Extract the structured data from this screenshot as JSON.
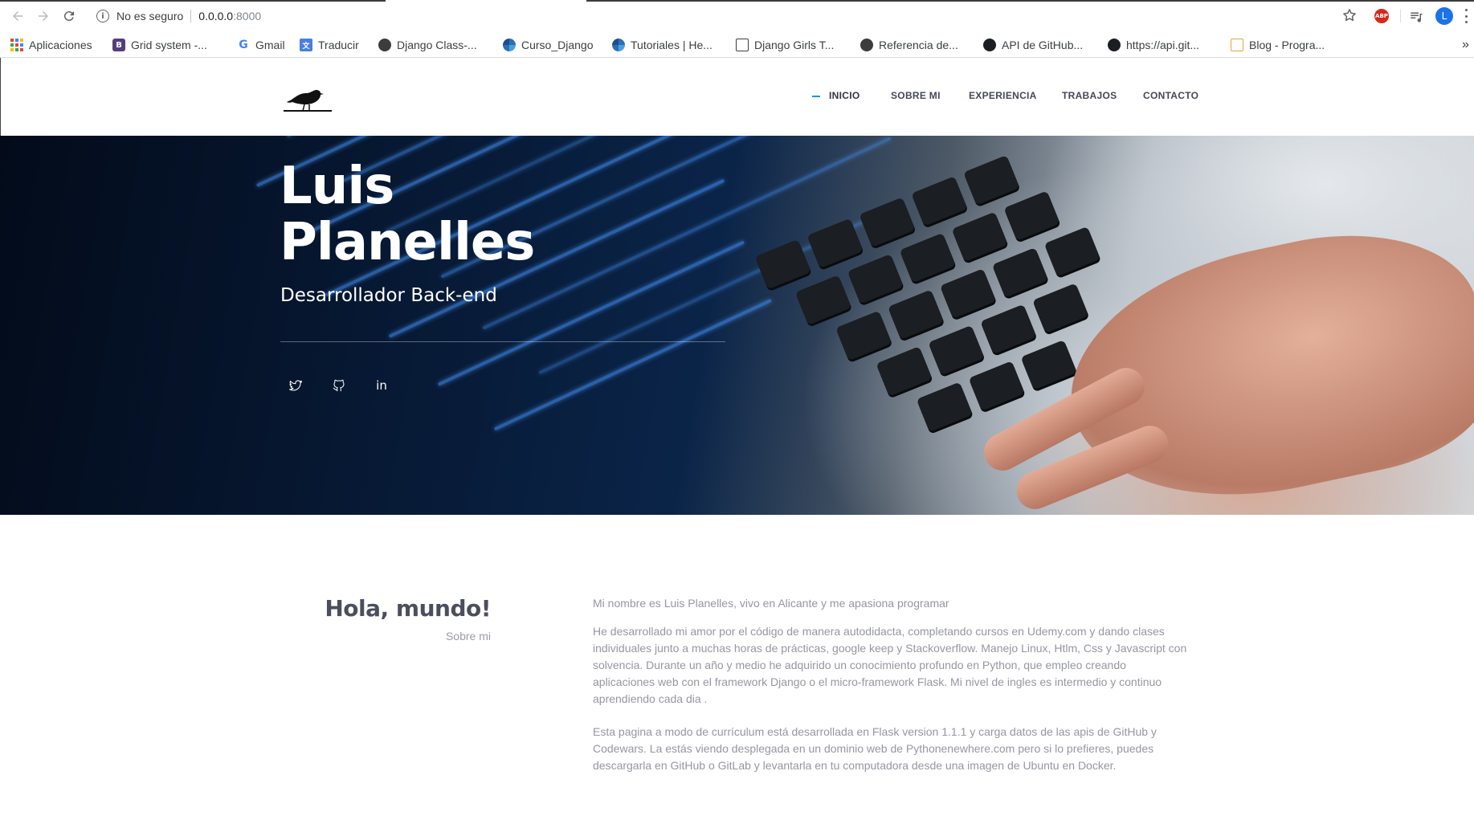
{
  "browser": {
    "security_text": "No es seguro",
    "url_host": "0.0.0.0",
    "url_port": ":8000",
    "avatar_letter": "L",
    "abp_label": "ABP",
    "bookmarks": [
      {
        "label": "Aplicaciones",
        "icon": "apps-grid-icon"
      },
      {
        "label": "Grid system -...",
        "icon": "bootstrap-icon"
      },
      {
        "label": "Gmail",
        "icon": "google-icon"
      },
      {
        "label": "Traducir",
        "icon": "translate-icon"
      },
      {
        "label": "Django Class-...",
        "icon": "globe-icon"
      },
      {
        "label": "Curso_Django",
        "icon": "globe-color-icon"
      },
      {
        "label": "Tutoriales | He...",
        "icon": "globe-color-icon"
      },
      {
        "label": "Django Girls T...",
        "icon": "book-icon"
      },
      {
        "label": "Referencia de...",
        "icon": "globe-icon"
      },
      {
        "label": "API de GitHub...",
        "icon": "github-icon"
      },
      {
        "label": "https://api.git...",
        "icon": "github-icon"
      },
      {
        "label": "Blog - Progra...",
        "icon": "blog-icon"
      }
    ],
    "more_label": "»"
  },
  "nav": {
    "items": [
      "INICIO",
      "SOBRE MI",
      "EXPERIENCIA",
      "TRABAJOS",
      "CONTACTO"
    ],
    "active": "INICIO",
    "accent_color": "#1e90ff"
  },
  "hero": {
    "title_line1": "Luis",
    "title_line2": "Planelles",
    "subtitle": "Desarrollador Back-end",
    "social": [
      "twitter-icon",
      "github-icon",
      "linkedin-icon"
    ]
  },
  "about": {
    "title": "Hola, mundo!",
    "subtitle": "Sobre mi",
    "intro": "Mi nombre es Luis Planelles, vivo en Alicante y me apasiona programar",
    "paragraph1": "He desarrollado mi amor por el código de manera autodidacta, completando cursos en Udemy.com y dando clases individuales junto a muchas horas de prácticas, google keep y Stackoverflow. Manejo Linux, Htlm, Css y Javascript con solvencia. Durante un año y medio he adquirido un conocimiento profundo en Python, que empleo creando aplicaciones web con el framework Django o el micro-framework Flask. Mi nivel de ingles es intermedio y continuo aprendiendo cada dia .",
    "paragraph2": "Esta pagina a modo de currículum está desarrollada en Flask version 1.1.1 y carga datos de las apis de GitHub y Codewars. La estás viendo desplegada en un dominio web de Pythonenewhere.com pero si lo prefieres, puedes descargarla en GitHub o GitLab y levantarla en tu computadora desde una imagen de Ubuntu en Docker."
  }
}
